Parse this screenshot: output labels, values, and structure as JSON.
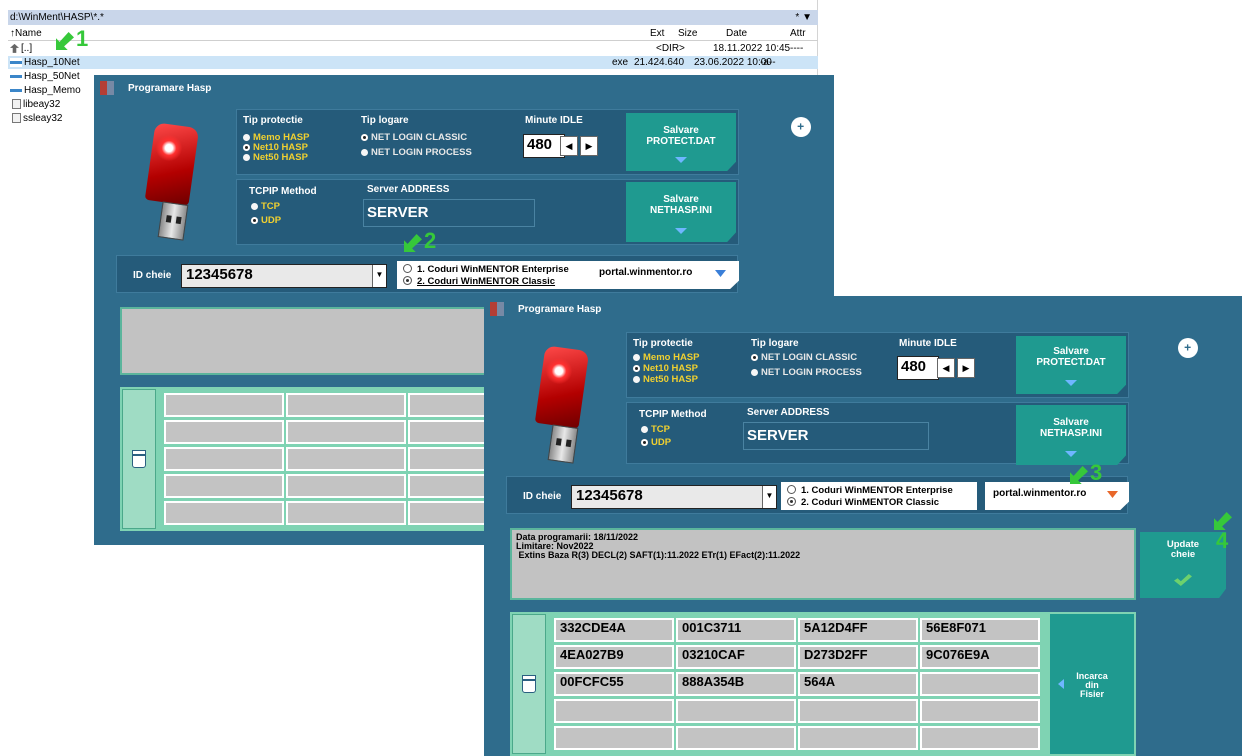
{
  "file_manager": {
    "path": "d:\\WinMent\\HASP\\*.*",
    "path_controls": "* ▼",
    "columns": {
      "name": "↑Name",
      "ext": "Ext",
      "size": "Size",
      "date": "Date",
      "attr": "Attr"
    },
    "rows": [
      {
        "name": "[..]",
        "ext": "",
        "size": "<DIR>",
        "date": "18.11.2022 10:45",
        "attr": "----",
        "icon": "up-folder-icon"
      },
      {
        "name": "Hasp_10Net",
        "ext": "exe",
        "size": "21.424.640",
        "date": "23.06.2022 10:00",
        "attr": "-a--",
        "icon": "exe-icon",
        "selected": true
      },
      {
        "name": "Hasp_50Net",
        "icon": "exe-icon"
      },
      {
        "name": "Hasp_Memo",
        "icon": "exe-icon"
      },
      {
        "name": "libeay32",
        "icon": "dll-icon"
      },
      {
        "name": "ssleay32",
        "icon": "dll-icon"
      }
    ]
  },
  "markers": [
    "1",
    "2",
    "3",
    "4"
  ],
  "hasp": {
    "title": "Programare Hasp",
    "tip_protectie": "Tip protectie",
    "protectie_options": [
      "Memo HASP",
      "Net10 HASP",
      "Net50 HASP"
    ],
    "protectie_selected": 1,
    "tip_logare": "Tip logare",
    "logare_options": [
      "NET LOGIN CLASSIC",
      "NET LOGIN PROCESS"
    ],
    "logare_selected": 0,
    "minute_idle_label": "Minute IDLE",
    "minute_idle": "480",
    "nav_prev": "◀",
    "nav_next": "▶",
    "salvare_protect": "Salvare\nPROTECT.DAT",
    "tcpip_method": "TCPIP Method",
    "tcpip_options": [
      "TCP",
      "UDP"
    ],
    "tcpip_selected": 1,
    "server_address_label": "Server ADDRESS",
    "server_address": "SERVER",
    "salvare_nethasp": "Salvare\nNETHASP.INI",
    "id_cheie_label": "ID cheie",
    "id_cheie": "12345678",
    "coduri_options": [
      "1. Coduri WinMENTOR Enterprise",
      "2. Coduri WinMENTOR Classic"
    ],
    "coduri_selected": 1,
    "portal": "portal.winmentor.ro",
    "colors": {
      "window_bg": "#2f6c8c",
      "teal_button": "#1f9a90",
      "portal_arrow_blue": "#3a7fd8",
      "portal_arrow_orange": "#e8672a",
      "marker_green": "#36c83a"
    }
  },
  "hasp2": {
    "info_lines": "Data programarii: 18/11/2022\nLimitare: Nov2022\n Extins Baza R(3) DECL(2) SAFT(1):11.2022 ETr(1) EFact(2):11.2022",
    "update_cheie": "Update\ncheie",
    "incarca": "Incarca\ndin\nFisier",
    "codes": [
      [
        "332CDE4A",
        "001C3711",
        "5A12D4FF",
        "56E8F071"
      ],
      [
        "4EA027B9",
        "03210CAF",
        "D273D2FF",
        "9C076E9A"
      ],
      [
        "00FCFC55",
        "888A354B",
        "564A",
        ""
      ],
      [
        "",
        "",
        "",
        ""
      ],
      [
        "",
        "",
        "",
        ""
      ]
    ]
  }
}
